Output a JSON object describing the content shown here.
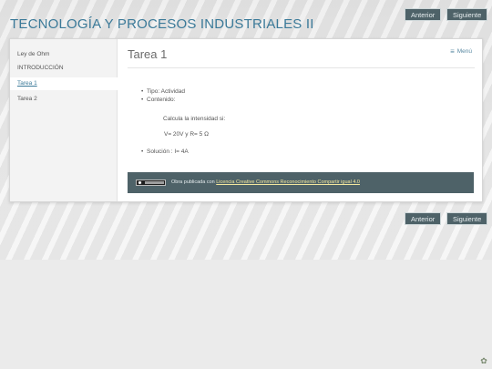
{
  "header": {
    "title": "TECNOLOGÍA Y PROCESOS INDUSTRIALES II",
    "prev_label": "Anterior",
    "next_label": "Siguiente"
  },
  "sidebar": {
    "items": [
      {
        "label": "Ley de Ohm",
        "active": false
      },
      {
        "label": "INTRODUCCIÓN",
        "active": false
      },
      {
        "label": "Tarea 1",
        "active": true
      },
      {
        "label": "Tarea 2",
        "active": false
      }
    ]
  },
  "content": {
    "title": "Tarea 1",
    "menu_label": "Menú",
    "menu_icon": "hamburger-icon",
    "type_line": "Tipo: Actividad",
    "content_label": "Contenido:",
    "instruction": "Calcula la intensidad si:",
    "values": "V= 20V y   R= 5 Ω",
    "solution": "Solución :  I= 4A"
  },
  "license": {
    "icon": "creative-commons-icon",
    "text": "Obra publicada con ",
    "link_label": "Licencia Creative Commons Reconocimiento Compartir igual 4.0"
  },
  "footer_nav": {
    "prev_label": "Anterior",
    "next_label": "Siguiente"
  },
  "colors": {
    "accent": "#3b7a99",
    "button_bg": "#4e6268",
    "link": "#f3e79e"
  }
}
